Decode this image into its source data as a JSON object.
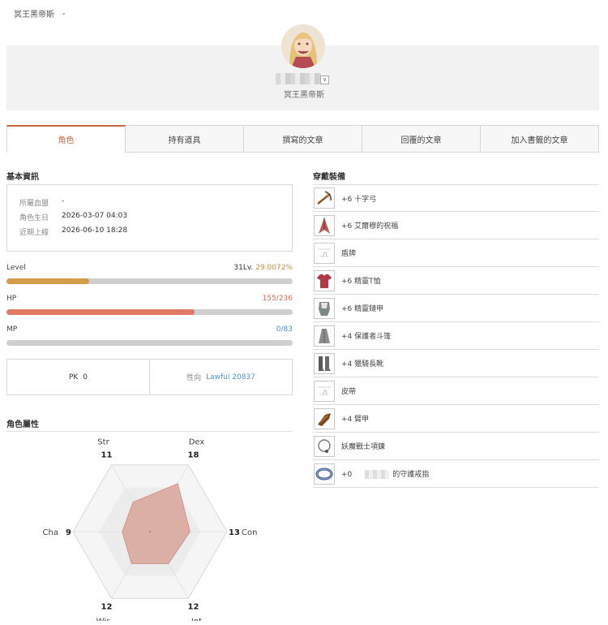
{
  "header": {
    "server_name": "冥王黑帝斯",
    "dropdown_glyph": "⌄"
  },
  "profile": {
    "server_name": "冥王黑帝斯",
    "name_dropdown_glyph": "∨"
  },
  "tabs": [
    {
      "label": "角色",
      "active": true
    },
    {
      "label": "持有道具",
      "active": false
    },
    {
      "label": "撰寫的文章",
      "active": false
    },
    {
      "label": "回覆的文章",
      "active": false
    },
    {
      "label": "加入書籤的文章",
      "active": false
    }
  ],
  "basic_info": {
    "title": "基本資訊",
    "rows": [
      {
        "label": "所屬血盟",
        "value": "-"
      },
      {
        "label": "角色生日",
        "value": "2026-03-07 04:03"
      },
      {
        "label": "近期上線",
        "value": "2026-06-10 18:28"
      }
    ]
  },
  "stats": {
    "level": {
      "label": "Level",
      "level_text": "31Lv.",
      "percent_text": "29.0072%",
      "fraction": 0.29
    },
    "hp": {
      "label": "HP",
      "value_text": "155/236",
      "fraction": 0.657
    },
    "mp": {
      "label": "MP",
      "value_text": "0/83",
      "fraction": 0
    }
  },
  "pk": {
    "pk_label": "PK",
    "pk_value": "0",
    "alignment_label": "性向",
    "alignment_value": "Lawful 20837"
  },
  "attributes": {
    "title": "角色屬性",
    "items": [
      {
        "name": "Str",
        "value": 11
      },
      {
        "name": "Dex",
        "value": 18
      },
      {
        "name": "Con",
        "value": 13
      },
      {
        "name": "Int",
        "value": 12
      },
      {
        "name": "Wis",
        "value": 12
      },
      {
        "name": "Cha",
        "value": 9
      }
    ],
    "max": 25
  },
  "equipment": {
    "title": "穿戴裝備",
    "items": [
      {
        "name": "+6 十字弓",
        "icon": "crossbow-icon"
      },
      {
        "name": "+6 艾爾穆的祝福",
        "icon": "cloak-icon"
      },
      {
        "name": "盾牌",
        "icon": "empty-slot-icon"
      },
      {
        "name": "+6 精靈T恤",
        "icon": "tshirt-icon"
      },
      {
        "name": "+6 精靈鏈甲",
        "icon": "armor-icon"
      },
      {
        "name": "+4 保護者斗篷",
        "icon": "cape-icon"
      },
      {
        "name": "+4 獵騎長靴",
        "icon": "boots-icon"
      },
      {
        "name": "皮帶",
        "icon": "empty-slot-icon"
      },
      {
        "name": "+4 臂甲",
        "icon": "gauntlet-icon"
      },
      {
        "name": "妖魔戰士項鍊",
        "icon": "necklace-icon"
      },
      {
        "name": "+0",
        "suffix": "的守護戒指",
        "icon": "ring-icon"
      }
    ]
  },
  "colors": {
    "accent": "#c5643f",
    "level_bar": "#d39c4d",
    "hp_bar": "#e07a66",
    "mp_text": "#4a8fcf",
    "lawful_text": "#4a8fcf",
    "radar_fill": "#d9a49a"
  }
}
